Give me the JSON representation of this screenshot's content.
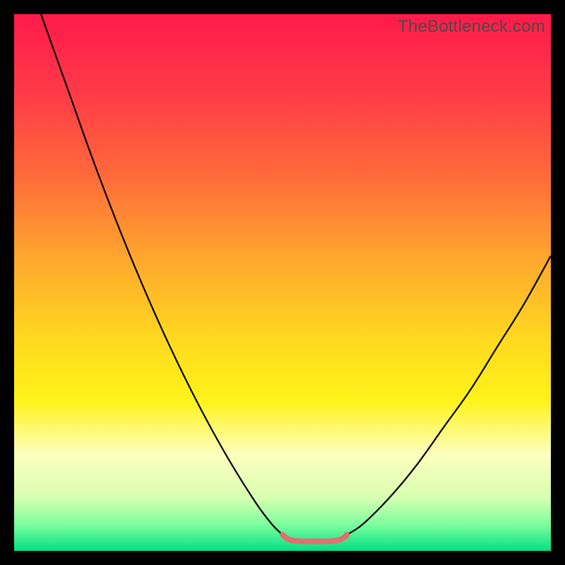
{
  "watermark": "TheBottleneck.com",
  "chart_data": {
    "type": "line",
    "title": "",
    "xlabel": "",
    "ylabel": "",
    "xlim": [
      0,
      100
    ],
    "ylim": [
      0,
      100
    ],
    "gradient_stops": [
      {
        "offset": 0.0,
        "color": "#ff1a4b"
      },
      {
        "offset": 0.15,
        "color": "#ff3b47"
      },
      {
        "offset": 0.3,
        "color": "#ff6a3a"
      },
      {
        "offset": 0.45,
        "color": "#ffa52e"
      },
      {
        "offset": 0.6,
        "color": "#ffd71f"
      },
      {
        "offset": 0.72,
        "color": "#fff31a"
      },
      {
        "offset": 0.82,
        "color": "#fdffbf"
      },
      {
        "offset": 0.9,
        "color": "#d8ffb0"
      },
      {
        "offset": 0.95,
        "color": "#7fff9e"
      },
      {
        "offset": 1.0,
        "color": "#00e083"
      }
    ],
    "series": [
      {
        "name": "left-curve",
        "stroke": "#000000",
        "stroke_width": 2.2,
        "x": [
          5,
          10,
          15,
          20,
          25,
          30,
          35,
          40,
          45,
          48,
          50
        ],
        "y": [
          100,
          86,
          72,
          59,
          47,
          36,
          26,
          17,
          9,
          5,
          3
        ]
      },
      {
        "name": "right-curve",
        "stroke": "#000000",
        "stroke_width": 2.2,
        "x": [
          62,
          65,
          70,
          75,
          80,
          85,
          90,
          95,
          100
        ],
        "y": [
          3,
          5,
          10,
          16,
          23,
          30,
          38,
          46,
          55
        ]
      },
      {
        "name": "bottom-highlight",
        "stroke": "#e36f6f",
        "stroke_width": 8,
        "linecap": "round",
        "x": [
          50,
          51,
          53,
          56,
          59,
          61,
          62
        ],
        "y": [
          3.0,
          2.2,
          1.8,
          1.8,
          1.8,
          2.2,
          3.0
        ]
      }
    ],
    "annotations": []
  }
}
